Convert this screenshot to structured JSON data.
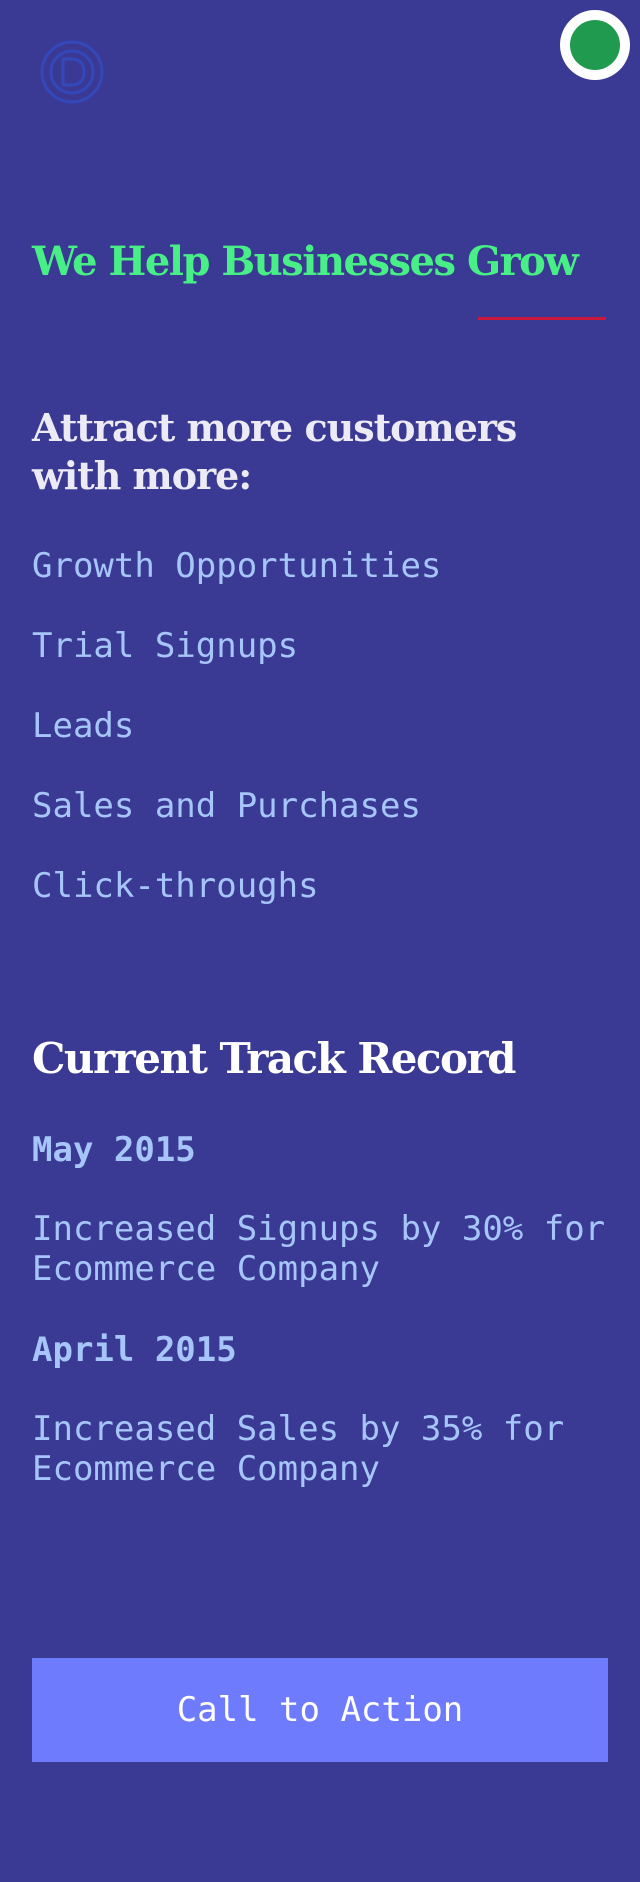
{
  "header": {
    "logo_icon": "circle-d-logo",
    "status_indicator_color": "#1f9a4e"
  },
  "hero": {
    "headline": "We Help Businesses Grow",
    "headline_color": "#47ef86",
    "underline_color": "#c8193c"
  },
  "benefits": {
    "title": "Attract more customers with more:",
    "items": [
      "Growth Opportunities",
      "Trial Signups",
      "Leads",
      "Sales and Purchases",
      "Click-throughs"
    ]
  },
  "track_record": {
    "title": "Current Track Record",
    "entries": [
      {
        "date": "May 2015",
        "text": "Increased Signups by 30% for Ecommerce Company"
      },
      {
        "date": "April 2015",
        "text": "Increased Sales by 35% for Ecommerce Company"
      }
    ]
  },
  "cta": {
    "label": "Call to Action",
    "color": "#6f7bfd"
  },
  "theme": {
    "background": "#3a3a94",
    "text_muted": "#a6c6fa"
  }
}
